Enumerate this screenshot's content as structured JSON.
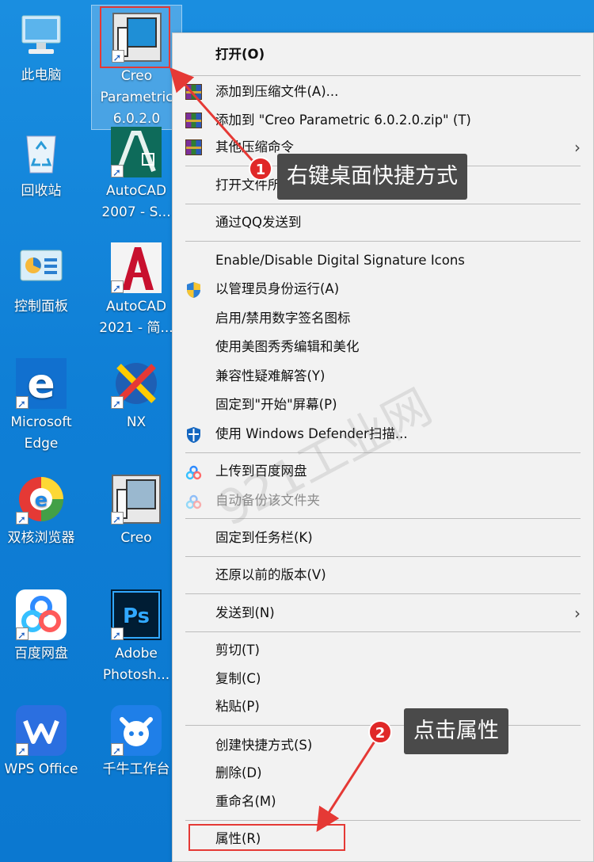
{
  "desktop": {
    "icons": [
      {
        "label": "此电脑",
        "icon": "computer-icon",
        "shortcut": false
      },
      {
        "label": "Creo\nParametric\n6.0.2.0",
        "icon": "creo-icon",
        "shortcut": true,
        "selected": true
      },
      {
        "label": "回收站",
        "icon": "recycle-bin-icon",
        "shortcut": false
      },
      {
        "label": "AutoCAD\n2007 - S...",
        "icon": "autocad2007-icon",
        "shortcut": true
      },
      {
        "label": "控制面板",
        "icon": "control-panel-icon",
        "shortcut": false
      },
      {
        "label": "AutoCAD\n2021 - 简...",
        "icon": "autocad2021-icon",
        "shortcut": true
      },
      {
        "label": "Microsoft\nEdge",
        "icon": "edge-icon",
        "shortcut": true
      },
      {
        "label": "NX",
        "icon": "nx-icon",
        "shortcut": true
      },
      {
        "label": "双核浏览器",
        "icon": "dual-core-browser-icon",
        "shortcut": true
      },
      {
        "label": "Creo",
        "icon": "creo-icon",
        "shortcut": true
      },
      {
        "label": "百度网盘",
        "icon": "baidu-netdisk-icon",
        "shortcut": true
      },
      {
        "label": "Adobe\nPhotosh...",
        "icon": "photoshop-icon",
        "shortcut": true
      },
      {
        "label": "WPS Office",
        "icon": "wps-office-icon",
        "shortcut": true
      },
      {
        "label": "千牛工作台",
        "icon": "qianniu-icon",
        "shortcut": true
      }
    ]
  },
  "menu": {
    "items": [
      {
        "label": "打开(O)",
        "bold": true
      },
      {
        "label": "添加到压缩文件(A)...",
        "icon": "winrar-icon"
      },
      {
        "label": "添加到 \"Creo Parametric 6.0.2.0.zip\" (T)",
        "icon": "winrar-icon"
      },
      {
        "label": "其他压缩命令",
        "icon": "winrar-icon",
        "submenu": true
      },
      {
        "label": "打开文件所在的位置(I)"
      },
      {
        "label": "通过QQ发送到"
      },
      {
        "label": "Enable/Disable Digital Signature Icons"
      },
      {
        "label": "以管理员身份运行(A)",
        "icon": "uac-shield-icon"
      },
      {
        "label": "启用/禁用数字签名图标"
      },
      {
        "label": "使用美图秀秀编辑和美化"
      },
      {
        "label": "兼容性疑难解答(Y)"
      },
      {
        "label": "固定到\"开始\"屏幕(P)"
      },
      {
        "label": "使用 Windows Defender扫描...",
        "icon": "defender-icon"
      },
      {
        "label": "上传到百度网盘",
        "icon": "baidu-cloud-icon"
      },
      {
        "label": "自动备份该文件夹",
        "icon": "baidu-cloud-icon",
        "disabled": true
      },
      {
        "label": "固定到任务栏(K)"
      },
      {
        "label": "还原以前的版本(V)"
      },
      {
        "label": "发送到(N)",
        "submenu": true
      },
      {
        "label": "剪切(T)"
      },
      {
        "label": "复制(C)"
      },
      {
        "label": "粘贴(P)"
      },
      {
        "label": "创建快捷方式(S)"
      },
      {
        "label": "删除(D)"
      },
      {
        "label": "重命名(M)"
      },
      {
        "label": "属性(R)"
      }
    ]
  },
  "annotations": {
    "step1_number": "1",
    "step1_text": "右键桌面快捷方式",
    "step2_number": "2",
    "step2_text": "点击属性",
    "accent_color": "#e53935"
  },
  "watermark": "921工业网"
}
